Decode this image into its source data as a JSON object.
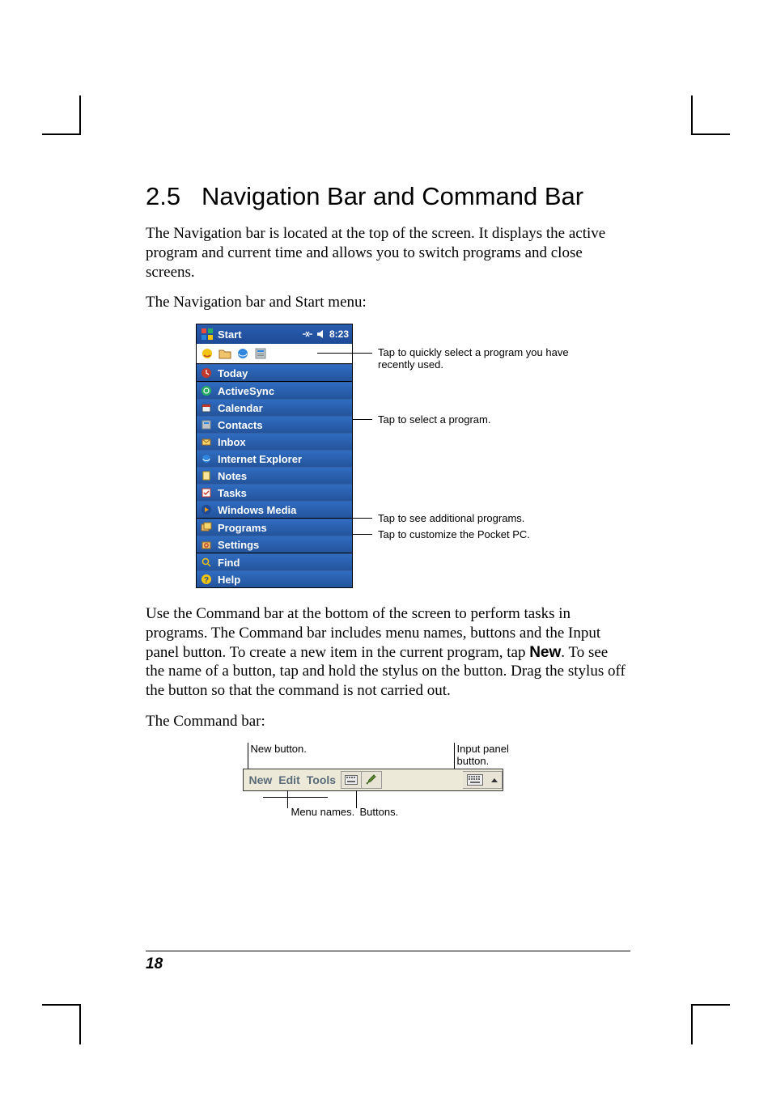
{
  "section": {
    "number": "2.5",
    "title": "Navigation Bar and Command Bar"
  },
  "para1": "The Navigation bar is located at the top of the screen. It displays the active program and current time and allows you to switch programs and close screens.",
  "para2": "The Navigation bar and Start menu:",
  "start_menu": {
    "title": "Start",
    "time": "8:23",
    "recent_icons": [
      "msn-icon",
      "folder-icon",
      "ie-icon",
      "contacts-icon"
    ],
    "groups": [
      [
        {
          "icon": "today-icon",
          "label": "Today"
        }
      ],
      [
        {
          "icon": "activesync-icon",
          "label": "ActiveSync"
        },
        {
          "icon": "calendar-icon",
          "label": "Calendar"
        },
        {
          "icon": "contacts-icon",
          "label": "Contacts"
        },
        {
          "icon": "inbox-icon",
          "label": "Inbox"
        },
        {
          "icon": "ie-icon",
          "label": "Internet Explorer"
        },
        {
          "icon": "notes-icon",
          "label": "Notes"
        },
        {
          "icon": "tasks-icon",
          "label": "Tasks"
        },
        {
          "icon": "wmp-icon",
          "label": "Windows Media"
        }
      ],
      [
        {
          "icon": "programs-icon",
          "label": "Programs"
        },
        {
          "icon": "settings-icon",
          "label": "Settings"
        }
      ],
      [
        {
          "icon": "find-icon",
          "label": "Find"
        },
        {
          "icon": "help-icon",
          "label": "Help"
        }
      ]
    ]
  },
  "callouts": {
    "recent": "Tap to quickly select a program you have recently used.",
    "programs_list": "Tap to select a program.",
    "programs": "Tap to see additional programs.",
    "settings": "Tap to customize the Pocket PC."
  },
  "para3a": "Use the Command bar at the bottom of the screen to perform tasks in programs. The Command bar includes menu names, buttons and the Input panel button. To create a new item in the current program, tap ",
  "para3_bold": "New",
  "para3b": ". To see the name of a button, tap and hold the stylus on the button. Drag the stylus off the button so that the command is not carried out.",
  "para4": "The Command bar:",
  "command_bar": {
    "labels": {
      "new_button": "New button.",
      "input_panel": "Input panel button.",
      "menu_names": "Menu names.",
      "buttons": "Buttons."
    },
    "menus": [
      "New",
      "Edit",
      "Tools"
    ]
  },
  "page_number": "18"
}
